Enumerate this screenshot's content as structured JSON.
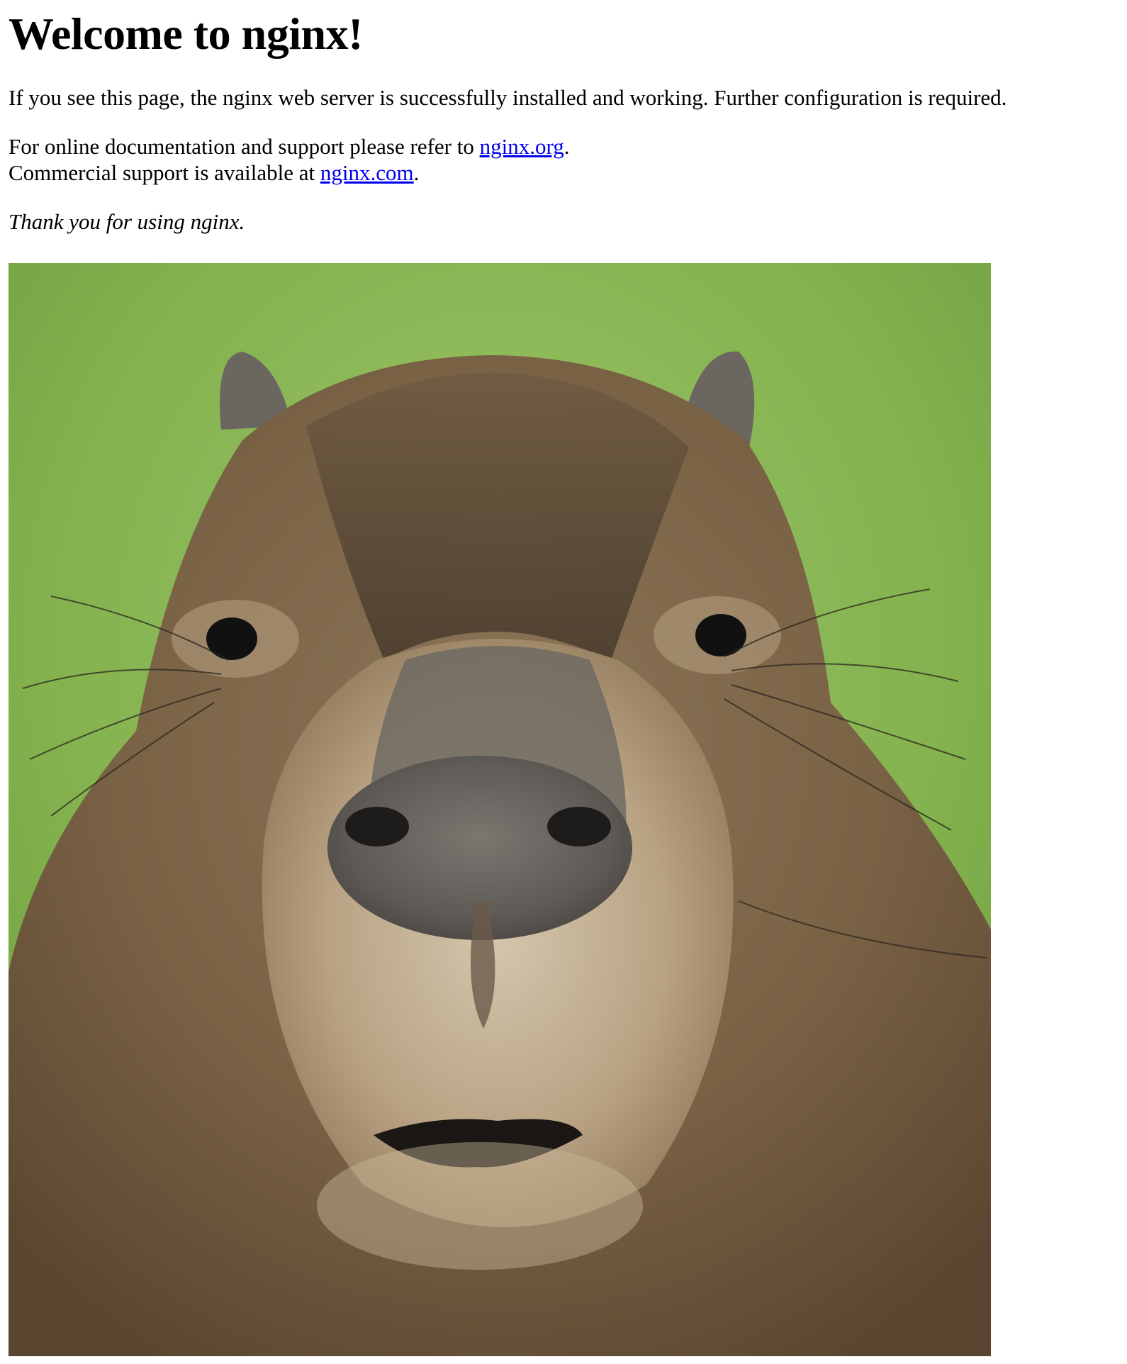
{
  "heading": "Welcome to nginx!",
  "intro": "If you see this page, the nginx web server is successfully installed and working. Further configuration is required.",
  "docs": {
    "prefix": "For online documentation and support please refer to ",
    "link_text": "nginx.org",
    "suffix": "."
  },
  "commercial": {
    "prefix": "Commercial support is available at ",
    "link_text": "nginx.com",
    "suffix": "."
  },
  "thanks": "Thank you for using nginx.",
  "image": {
    "subject": "capybara-face-photo",
    "colors": {
      "background_green": "#8fbb5a",
      "fur_brown": "#7a6245",
      "fur_light": "#b8a283",
      "nose_gray": "#5e5a55"
    }
  }
}
